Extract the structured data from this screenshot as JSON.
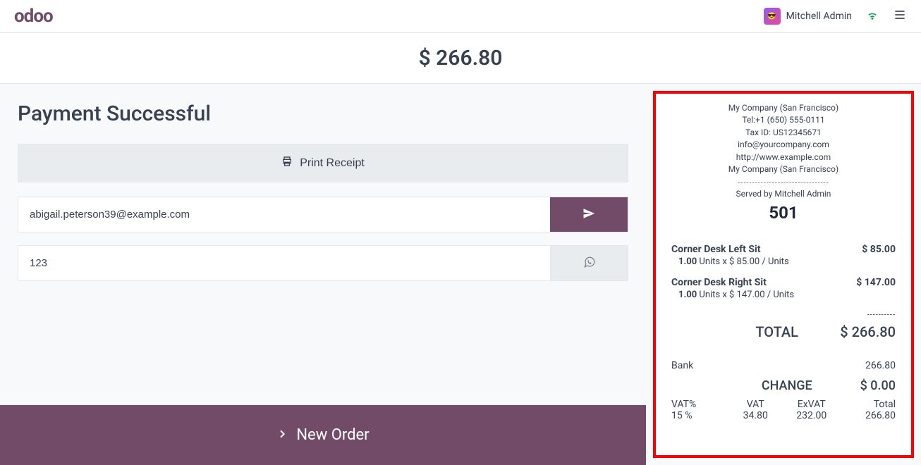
{
  "header": {
    "logo_text": "odoo",
    "user_name": "Mitchell Admin"
  },
  "total_bar": "$ 266.80",
  "left": {
    "title": "Payment Successful",
    "print_label": "Print Receipt",
    "email_value": "abigail.peterson39@example.com",
    "phone_value": "123",
    "new_order_label": "New Order"
  },
  "receipt": {
    "company": "My Company (San Francisco)",
    "tel": "Tel:+1 (650) 555-0111",
    "tax_id": "Tax ID: US12345671",
    "email": "info@yourcompany.com",
    "website": "http://www.example.com",
    "company2": "My Company (San Francisco)",
    "served_by": "Served by Mitchell Admin",
    "order_number": "501",
    "lines": [
      {
        "name": "Corner Desk Left Sit",
        "price": "$ 85.00",
        "qty": "1.00",
        "unit_detail": "Units x $ 85.00 / Units"
      },
      {
        "name": "Corner Desk Right Sit",
        "price": "$ 147.00",
        "qty": "1.00",
        "unit_detail": "Units x $ 147.00 / Units"
      }
    ],
    "total_label": "TOTAL",
    "total_value": "$ 266.80",
    "payment_method": "Bank",
    "payment_amount": "266.80",
    "change_label": "CHANGE",
    "change_value": "$ 0.00",
    "tax_headers": {
      "vat_pct": "VAT%",
      "vat": "VAT",
      "exvat": "ExVAT",
      "total": "Total"
    },
    "tax_row": {
      "vat_pct": "15 %",
      "vat": "34.80",
      "exvat": "232.00",
      "total": "266.80"
    }
  }
}
